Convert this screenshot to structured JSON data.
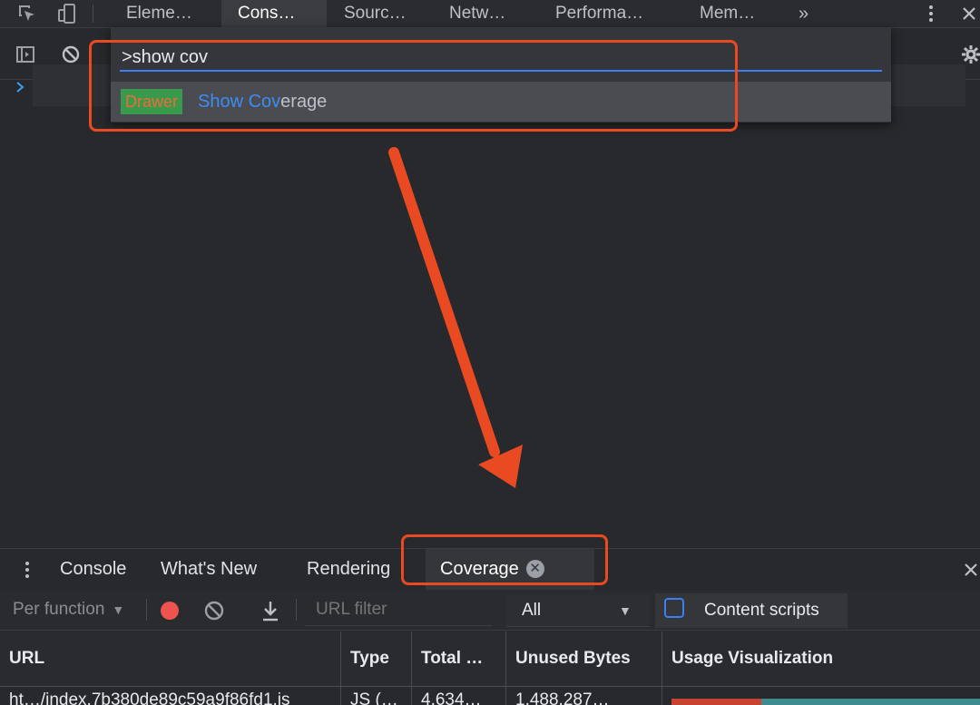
{
  "top_tabs": [
    "Eleme…",
    "Cons…",
    "Sourc…",
    "Netw…",
    "Performa…",
    "Mem…"
  ],
  "more_tabs_glyph": "»",
  "command_menu": {
    "query": ">show cov",
    "result": {
      "badge": "Drawer",
      "match": "Show Cov",
      "rest": "erage"
    }
  },
  "drawer": {
    "tabs": [
      "Console",
      "What's New",
      "Rendering",
      "Coverage"
    ],
    "close_glyph": "✕"
  },
  "coverage_toolbar": {
    "mode": "Per function",
    "url_filter_placeholder": "URL filter",
    "type_filter": "All",
    "content_scripts_label": "Content scripts"
  },
  "table": {
    "headers": [
      "URL",
      "Type",
      "Total …",
      "Unused Bytes",
      "Usage Visualization"
    ],
    "rows": [
      {
        "url": "ht…/index.7b380de89c59a9f86fd1.js",
        "type": "JS (…",
        "total": "4,634…",
        "unused": "1,488,287…",
        "used_fraction": 0.29
      }
    ]
  },
  "colors": {
    "accent": "#3d7ef4",
    "highlight": "#ea4a22",
    "record": "#ef5350",
    "used_bar": "#c8432f",
    "unused_bar": "#3f8c8f"
  }
}
